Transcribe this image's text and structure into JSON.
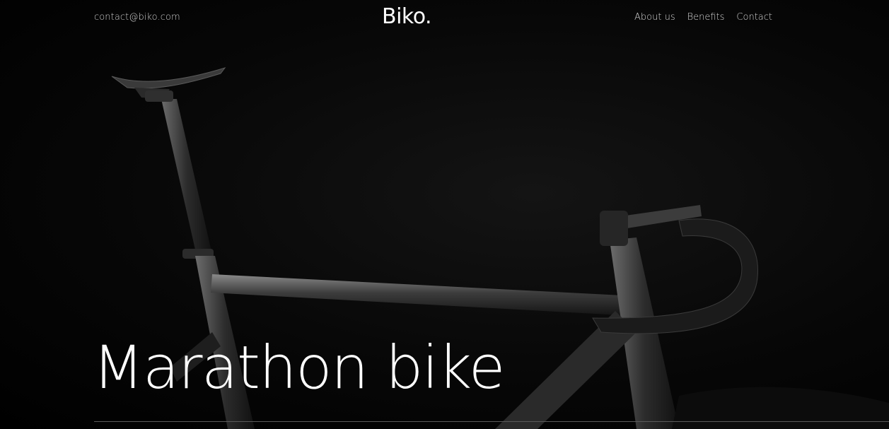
{
  "header": {
    "email": "contact@biko.com",
    "logo": "Biko.",
    "nav": [
      {
        "label": "About us"
      },
      {
        "label": "Benefits"
      },
      {
        "label": "Contact"
      }
    ]
  },
  "hero": {
    "headline": "Marathon bike",
    "background_color": "#000000",
    "image": "black road bicycle frame photo"
  }
}
